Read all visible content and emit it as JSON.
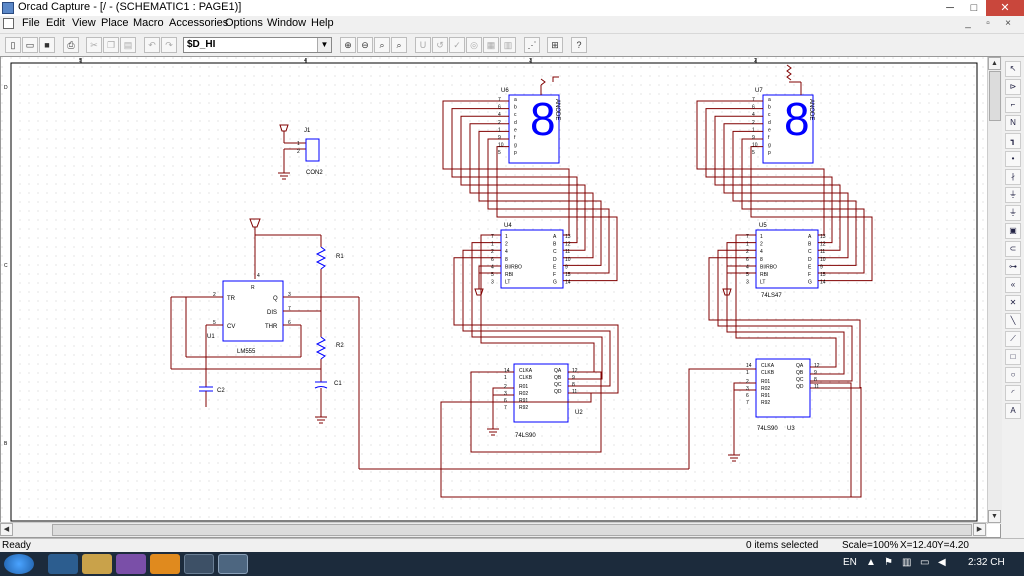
{
  "window": {
    "title": "Orcad Capture - [/ - (SCHEMATIC1 : PAGE1)]"
  },
  "menu": [
    "File",
    "Edit",
    "View",
    "Place",
    "Macro",
    "Accessories",
    "Options",
    "Window",
    "Help"
  ],
  "toolbar": {
    "part_combo_value": "$D_HI"
  },
  "schematic": {
    "border_ticks_top": [
      "5",
      "4",
      "3",
      "2"
    ],
    "border_ticks_left": [
      "D",
      "C",
      "B"
    ],
    "j1": {
      "ref": "J1",
      "name": "CON2",
      "pins": [
        "1",
        "2"
      ]
    },
    "u1": {
      "ref": "U1",
      "name": "LM555",
      "pins": {
        "tr": "TR",
        "q": "Q",
        "dis": "DIS",
        "cv": "CV",
        "thr": "THR",
        "r": "R"
      },
      "pin_nums": [
        "2",
        "3",
        "7",
        "5",
        "6",
        "4"
      ]
    },
    "r1": "R1",
    "r2": "R2",
    "c1": "C1",
    "c2": "C2",
    "u6": {
      "ref": "U6",
      "anode": "ANODE",
      "pins": [
        "a",
        "b",
        "c",
        "d",
        "e",
        "f",
        "g",
        "p"
      ],
      "nums": [
        "7",
        "6",
        "4",
        "2",
        "1",
        "9",
        "10",
        "5"
      ],
      "seg": "8"
    },
    "u7": {
      "ref": "U7",
      "anode": "ANODE",
      "pins": [
        "a",
        "b",
        "c",
        "d",
        "e",
        "f",
        "g",
        "p"
      ],
      "nums": [
        "7",
        "6",
        "4",
        "2",
        "1",
        "9",
        "10",
        "5"
      ],
      "seg": "8"
    },
    "u4": {
      "ref": "U4",
      "name": "",
      "in_pins": [
        "1",
        "2",
        "4",
        "8",
        "BI/RBO",
        "RBI",
        "LT"
      ],
      "in_nums": [
        "7",
        "1",
        "2",
        "6",
        "4",
        "5",
        "3"
      ],
      "out_pins": [
        "A",
        "B",
        "C",
        "D",
        "E",
        "F",
        "G"
      ],
      "out_nums": [
        "13",
        "12",
        "11",
        "10",
        "9",
        "15",
        "14"
      ]
    },
    "u5": {
      "ref": "U5",
      "name": "74LS47",
      "in_pins": [
        "1",
        "2",
        "4",
        "8",
        "BI/RBO",
        "RBI",
        "LT"
      ],
      "in_nums": [
        "7",
        "1",
        "2",
        "6",
        "4",
        "5",
        "3"
      ],
      "out_pins": [
        "A",
        "B",
        "C",
        "D",
        "E",
        "F",
        "G"
      ],
      "out_nums": [
        "13",
        "12",
        "11",
        "10",
        "9",
        "15",
        "14"
      ]
    },
    "u2": {
      "ref": "U2",
      "name": "74LS90",
      "in_pins": [
        "CLKA",
        "CLKB",
        "R01",
        "R02",
        "R91",
        "R92"
      ],
      "in_nums": [
        "14",
        "1",
        "2",
        "3",
        "6",
        "7"
      ],
      "out_pins": [
        "QA",
        "QB",
        "QC",
        "QD"
      ],
      "out_nums": [
        "12",
        "9",
        "8",
        "11"
      ]
    },
    "u3": {
      "ref": "U3",
      "name": "74LS90",
      "in_pins": [
        "CLKA",
        "CLKB",
        "R01",
        "R02",
        "R91",
        "R92"
      ],
      "in_nums": [
        "14",
        "1",
        "2",
        "3",
        "6",
        "7"
      ],
      "out_pins": [
        "QA",
        "QB",
        "QC",
        "QD"
      ],
      "out_nums": [
        "12",
        "9",
        "8",
        "11"
      ]
    }
  },
  "status": {
    "ready": "Ready",
    "selected": "0 items selected",
    "scale": "Scale=100%",
    "x": "X=12.40",
    "y": "Y=4.20"
  },
  "taskbar": {
    "lang": "EN",
    "time": "2:32 CH"
  },
  "colors": {
    "wire": "#800000",
    "part": "#0000ff",
    "ground": "#800000",
    "canvas": "#ffffff"
  }
}
